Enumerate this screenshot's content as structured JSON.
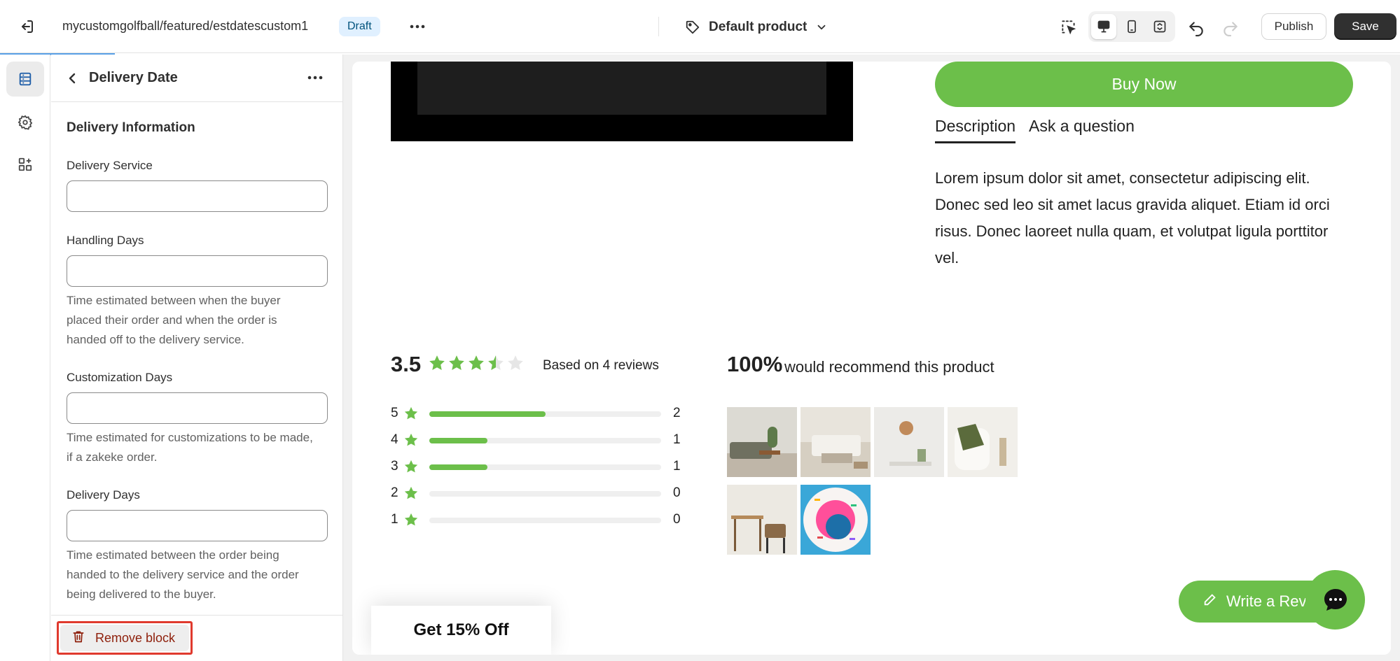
{
  "topbar": {
    "path": "mycustomgolfball/featured/estdatescustom1",
    "status_badge": "Draft",
    "product_selector": "Default product",
    "publish_label": "Publish",
    "save_label": "Save"
  },
  "panel": {
    "title": "Delivery Date",
    "section_title": "Delivery Information",
    "fields": [
      {
        "label": "Delivery Service",
        "value": "",
        "help": ""
      },
      {
        "label": "Handling Days",
        "value": "",
        "help": "Time estimated between when the buyer placed their order and when the order is handed off to the delivery service."
      },
      {
        "label": "Customization Days",
        "value": "",
        "help": "Time estimated for customizations to be made, if a zakeke order."
      },
      {
        "label": "Delivery Days",
        "value": "",
        "help": "Time estimated between the order being handed to the delivery service and the order being delivered to the buyer."
      }
    ],
    "remove_label": "Remove block"
  },
  "preview": {
    "buy_now": "Buy Now",
    "tabs": [
      "Description",
      "Ask a question"
    ],
    "description": "Lorem ipsum dolor sit amet, consectetur adipiscing elit. Donec sed leo sit amet lacus gravida aliquet. Etiam id orci risus. Donec laoreet nulla quam, et volutpat ligula porttitor vel.",
    "reviews": {
      "average": "3.5",
      "based_on": "Based on 4 reviews",
      "distribution": [
        {
          "stars": "5",
          "count": "2",
          "fraction": 0.5
        },
        {
          "stars": "4",
          "count": "1",
          "fraction": 0.25
        },
        {
          "stars": "3",
          "count": "1",
          "fraction": 0.25
        },
        {
          "stars": "2",
          "count": "0",
          "fraction": 0
        },
        {
          "stars": "1",
          "count": "0",
          "fraction": 0
        }
      ],
      "recommend_pct": "100%",
      "recommend_text": "would recommend this product"
    },
    "promo": "Get 15% Off",
    "write_review": "Write a Rev"
  },
  "colors": {
    "accent_green": "#6cbf4a",
    "remove_highlight": "#e03a2e",
    "save_bg": "#303030"
  }
}
